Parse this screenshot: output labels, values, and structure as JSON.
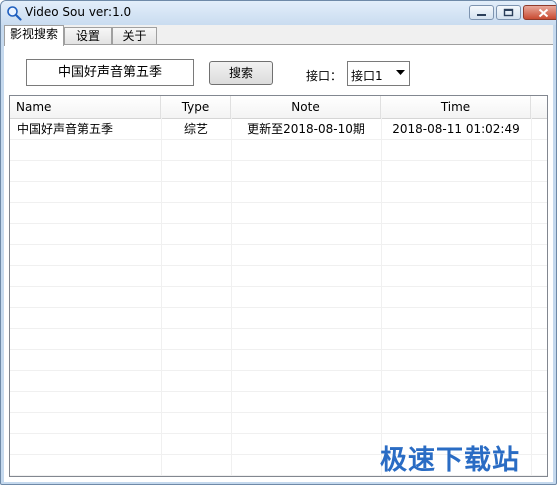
{
  "window": {
    "title": "Video Sou  ver:1.0"
  },
  "tabs": [
    {
      "label": "影视搜索"
    },
    {
      "label": "设置"
    },
    {
      "label": "关于"
    }
  ],
  "search": {
    "value": "中国好声音第五季",
    "button_label": "搜索"
  },
  "port": {
    "label": "接口：",
    "selected": "接口1"
  },
  "table": {
    "columns": [
      "Name",
      "Type",
      "Note",
      "Time"
    ],
    "rows": [
      {
        "name": "中国好声音第五季",
        "type": "综艺",
        "note": "更新至2018-08-10期",
        "time": "2018-08-11 01:02:49"
      }
    ]
  },
  "watermark": {
    "text": "极速下载站"
  }
}
